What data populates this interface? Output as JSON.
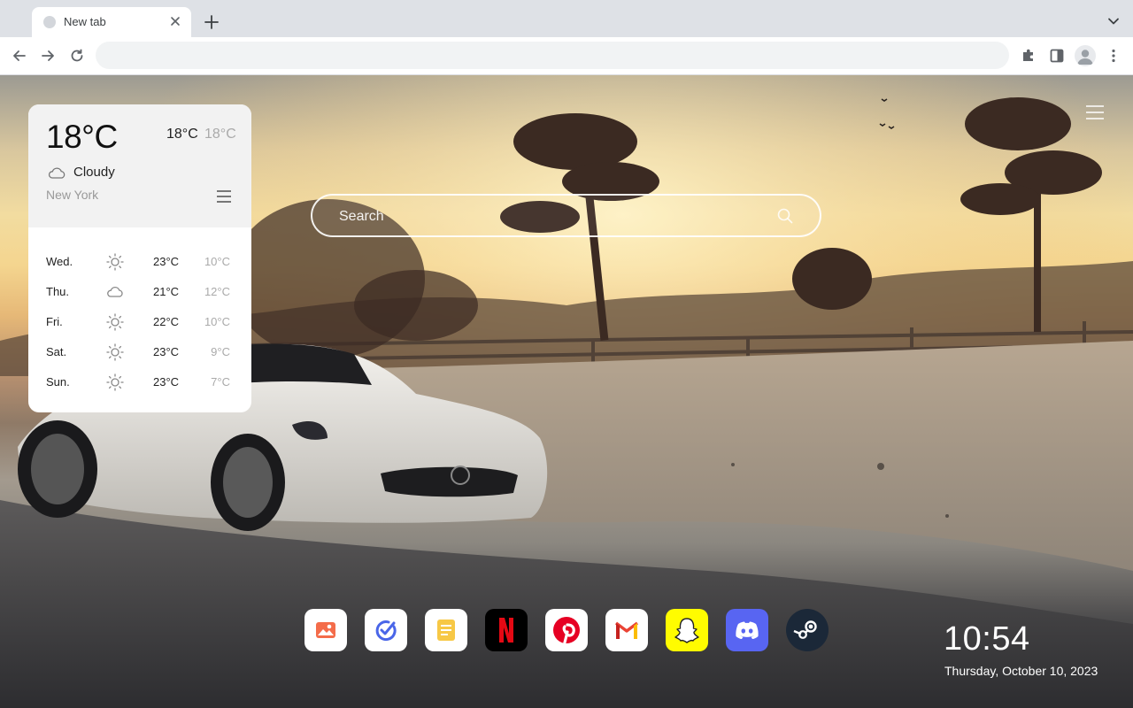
{
  "browser": {
    "tab": {
      "title": "New tab"
    },
    "omnibox": {
      "value": "",
      "placeholder": ""
    }
  },
  "weather": {
    "current_temp": "18°C",
    "high": "18°C",
    "low": "18°C",
    "condition": "Cloudy",
    "condition_icon": "cloud-icon",
    "city": "New York",
    "forecast": [
      {
        "day": "Wed.",
        "icon": "sun-icon",
        "high": "23°C",
        "low": "10°C"
      },
      {
        "day": "Thu.",
        "icon": "cloud-icon",
        "high": "21°C",
        "low": "12°C"
      },
      {
        "day": "Fri.",
        "icon": "sun-icon",
        "high": "22°C",
        "low": "10°C"
      },
      {
        "day": "Sat.",
        "icon": "sun-icon",
        "high": "23°C",
        "low": "9°C"
      },
      {
        "day": "Sun.",
        "icon": "sun-icon",
        "high": "23°C",
        "low": "7°C"
      }
    ]
  },
  "search": {
    "placeholder": "Search"
  },
  "dock": {
    "apps": [
      {
        "name": "photos",
        "icon": "photos-icon",
        "color": "#ffffff"
      },
      {
        "name": "tasks",
        "icon": "task-check-icon",
        "color": "#ffffff"
      },
      {
        "name": "notes",
        "icon": "notes-icon",
        "color": "#ffffff"
      },
      {
        "name": "netflix",
        "icon": "netflix-icon",
        "color": "#000000"
      },
      {
        "name": "pinterest",
        "icon": "pinterest-icon",
        "color": "#ffffff"
      },
      {
        "name": "gmail",
        "icon": "gmail-icon",
        "color": "#ffffff"
      },
      {
        "name": "snapchat",
        "icon": "snapchat-icon",
        "color": "#fffc00"
      },
      {
        "name": "discord",
        "icon": "discord-icon",
        "color": "#5865f2"
      },
      {
        "name": "steam",
        "icon": "steam-icon",
        "color": "#1b2838"
      }
    ]
  },
  "clock": {
    "time": "10:54",
    "date": "Thursday, October 10, 2023"
  },
  "colors": {
    "accent_red": "#e60023",
    "netflix_red": "#e50914",
    "snapchat_yellow": "#fffc00",
    "discord_blurple": "#5865f2"
  }
}
